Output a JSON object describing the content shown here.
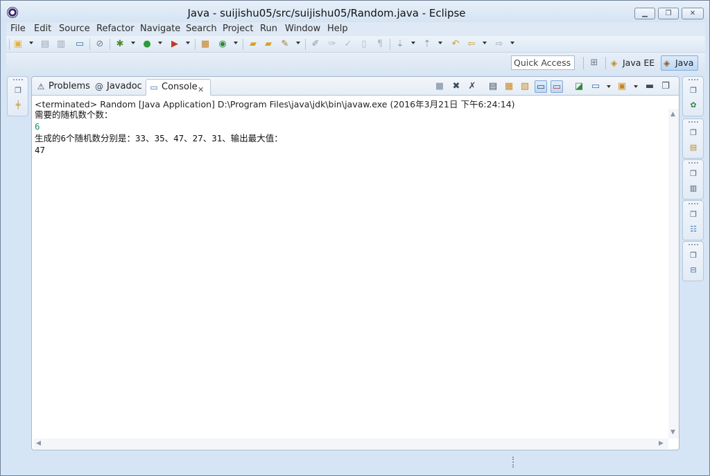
{
  "window": {
    "title": "Java - suijishu05/src/suijishu05/Random.java - Eclipse",
    "minimize_icon": "minimize-icon",
    "maximize_icon": "maximize-icon",
    "close_icon": "close-icon"
  },
  "menu": [
    "File",
    "Edit",
    "Source",
    "Refactor",
    "Navigate",
    "Search",
    "Project",
    "Run",
    "Window",
    "Help"
  ],
  "toolbar": {
    "quick_access": "Quick Access",
    "perspectives": [
      {
        "label": "Java EE",
        "icon": "java-ee-perspective-icon"
      },
      {
        "label": "Java",
        "icon": "java-perspective-icon"
      }
    ]
  },
  "view": {
    "tabs": [
      {
        "label": "Problems",
        "icon": "problems-icon"
      },
      {
        "label": "Javadoc",
        "icon": "javadoc-icon"
      },
      {
        "label": "Console",
        "icon": "console-icon"
      }
    ],
    "status": "<terminated> Random [Java Application] D:\\Program Files\\java\\jdk\\bin\\javaw.exe (2016年3月21日 下午6:24:14)",
    "console_lines": [
      {
        "text": "需要的随机数个数：",
        "kind": "output"
      },
      {
        "text": "6",
        "kind": "input"
      },
      {
        "text": "生成的6个随机数分别是：33、35、47、27、31、输出最大值：",
        "kind": "output"
      },
      {
        "text": "47",
        "kind": "output"
      }
    ]
  },
  "colors": {
    "input_text": "#1a8a6a",
    "chrome": "#d6e5f5"
  }
}
